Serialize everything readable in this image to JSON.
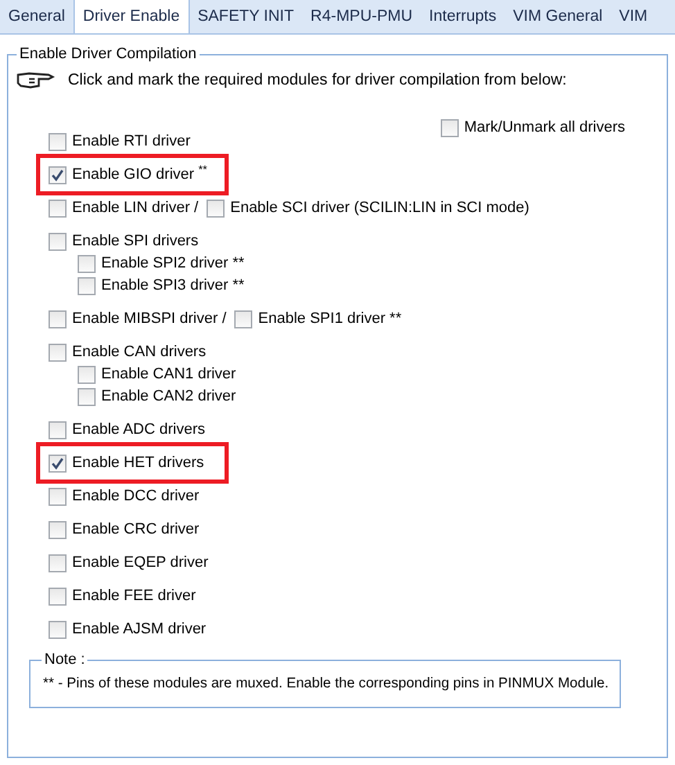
{
  "tabs": [
    {
      "label": "General",
      "selected": false
    },
    {
      "label": "Driver Enable",
      "selected": true
    },
    {
      "label": "SAFETY INIT",
      "selected": false
    },
    {
      "label": "R4-MPU-PMU",
      "selected": false
    },
    {
      "label": "Interrupts",
      "selected": false
    },
    {
      "label": "VIM General",
      "selected": false
    },
    {
      "label": "VIM",
      "selected": false
    }
  ],
  "group": {
    "title": "Enable Driver Compilation",
    "instruction": "Click and mark the required modules for driver compilation from below:",
    "mark_all": {
      "label": "Mark/Unmark all drivers",
      "checked": false
    },
    "rows": [
      {
        "highlighted": false,
        "items": [
          {
            "label": "Enable RTI driver",
            "checked": false
          }
        ]
      },
      {
        "highlighted": true,
        "items": [
          {
            "label": "Enable GIO driver $^{**}$",
            "checked": true
          }
        ]
      },
      {
        "highlighted": false,
        "items": [
          {
            "label": "Enable LIN driver /",
            "checked": false
          },
          {
            "label": "Enable SCI driver (SCILIN:LIN in SCI mode)",
            "checked": false
          }
        ]
      },
      {
        "highlighted": false,
        "items": [
          {
            "label": "Enable SPI drivers",
            "checked": false
          }
        ],
        "children": [
          {
            "label": "Enable SPI2 driver **",
            "checked": false
          },
          {
            "label": "Enable SPI3 driver **",
            "checked": false
          }
        ]
      },
      {
        "highlighted": false,
        "items": [
          {
            "label": "Enable MIBSPI driver /",
            "checked": false
          },
          {
            "label": "Enable SPI1 driver **",
            "checked": false
          }
        ]
      },
      {
        "highlighted": false,
        "items": [
          {
            "label": "Enable CAN drivers",
            "checked": false
          }
        ],
        "children": [
          {
            "label": "Enable CAN1 driver",
            "checked": false
          },
          {
            "label": "Enable CAN2 driver",
            "checked": false
          }
        ]
      },
      {
        "highlighted": false,
        "items": [
          {
            "label": "Enable ADC drivers",
            "checked": false
          }
        ]
      },
      {
        "highlighted": true,
        "items": [
          {
            "label": "Enable HET drivers",
            "checked": true
          }
        ]
      },
      {
        "highlighted": false,
        "items": [
          {
            "label": "Enable DCC driver",
            "checked": false
          }
        ]
      },
      {
        "highlighted": false,
        "items": [
          {
            "label": "Enable CRC driver",
            "checked": false
          }
        ]
      },
      {
        "highlighted": false,
        "items": [
          {
            "label": "Enable EQEP driver",
            "checked": false
          }
        ]
      },
      {
        "highlighted": false,
        "items": [
          {
            "label": "Enable FEE driver",
            "checked": false
          }
        ]
      },
      {
        "highlighted": false,
        "items": [
          {
            "label": "Enable AJSM driver",
            "checked": false
          }
        ]
      }
    ],
    "note": {
      "title": "Note :",
      "text": "** - Pins of these modules are muxed. Enable the corresponding pins in PINMUX Module."
    }
  }
}
